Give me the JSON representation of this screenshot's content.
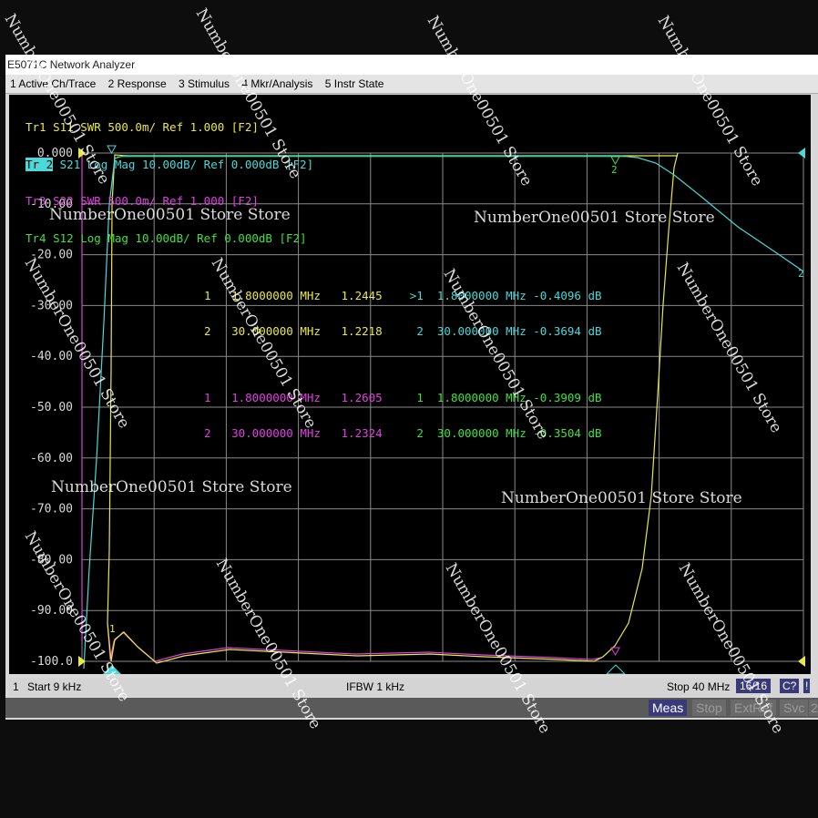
{
  "app": {
    "title": "E5071C Network Analyzer"
  },
  "menu": [
    "1 Active Ch/Trace",
    "2 Response",
    "3 Stimulus",
    "4 Mkr/Analysis",
    "5 Instr State"
  ],
  "traces": [
    {
      "label": "Tr1",
      "text": "S11 SWR 500.0m/ Ref 1.000 [F2]",
      "color": "#e8e84a"
    },
    {
      "label": "Tr 2",
      "text": "S21 Log Mag 10.00dB/ Ref 0.000dB [F2]",
      "color": "#4ad8d8",
      "active": true
    },
    {
      "label": "Tr3",
      "text": "S22 SWR 500.0m/ Ref 1.000 [F2]",
      "color": "#e040e0"
    },
    {
      "label": "Tr4",
      "text": "S12 Log Mag 10.00dB/ Ref 0.000dB [F2]",
      "color": "#40e040"
    }
  ],
  "y_ticks": [
    "0.000",
    "-10.00",
    "-20.00",
    "-30.00",
    "-40.00",
    "-50.00",
    "-60.00",
    "-70.00",
    "-80.00",
    "-90.00",
    "-100.0"
  ],
  "markers_table": [
    {
      "row": "1  1.8000000 MHz  1.2445    >1  1.8000000 MHz -0.4096 dB",
      "c1": "#e8e84a",
      "c2": "#4ad8d8"
    },
    {
      "row": "2  30.000000 MHz  1.2218     2  30.000000 MHz -0.3694 dB",
      "c1": "#e8e84a",
      "c2": "#4ad8d8"
    },
    {
      "row": "1  1.8000000 MHz  1.2605     1  1.8000000 MHz -0.3909 dB",
      "c1": "#e040e0",
      "c2": "#40e040"
    },
    {
      "row": "2  30.000000 MHz  1.2324     2  30.000000 MHz -0.3504 dB",
      "c1": "#e040e0",
      "c2": "#40e040"
    }
  ],
  "marker_table_left": {
    "r1": "1   1.8000000 MHz   1.2445",
    "r2": "2   30.000000 MHz   1.2218",
    "r3": "1   1.8000000 MHz   1.2605",
    "r4": "2   30.000000 MHz   1.2324"
  },
  "marker_table_right": {
    "r1": ">1  1.8000000 MHz -0.4096 dB",
    "r2": "2  30.000000 MHz -0.3694 dB",
    "r3": "1  1.8000000 MHz -0.3909 dB",
    "r4": "2  30.000000 MHz -0.3504 dB"
  },
  "status": {
    "channel": "1",
    "start": "Start 9 kHz",
    "ifbw": "IFBW 1 kHz",
    "stop": "Stop 40 MHz",
    "count": "16/16",
    "cal": "C?",
    "warn": "!"
  },
  "softkeys": [
    "Meas",
    "Stop",
    "ExtRef",
    "Svc",
    "2"
  ],
  "watermarks": {
    "horizontal": "NumberOne00501 Store Store",
    "diagonal": "NumberOne00501 Store"
  },
  "marker_flag": "2",
  "chart_data": {
    "type": "line",
    "xlim_hz": [
      9000,
      40000000
    ],
    "ylim_db": [
      -100,
      0
    ],
    "series": [
      {
        "name": "Tr1",
        "note_x": [
          0.0,
          0.03,
          0.07,
          0.35,
          0.6,
          0.74
        ],
        "values": []
      },
      {
        "name": "Tr 2",
        "values": []
      }
    ]
  }
}
